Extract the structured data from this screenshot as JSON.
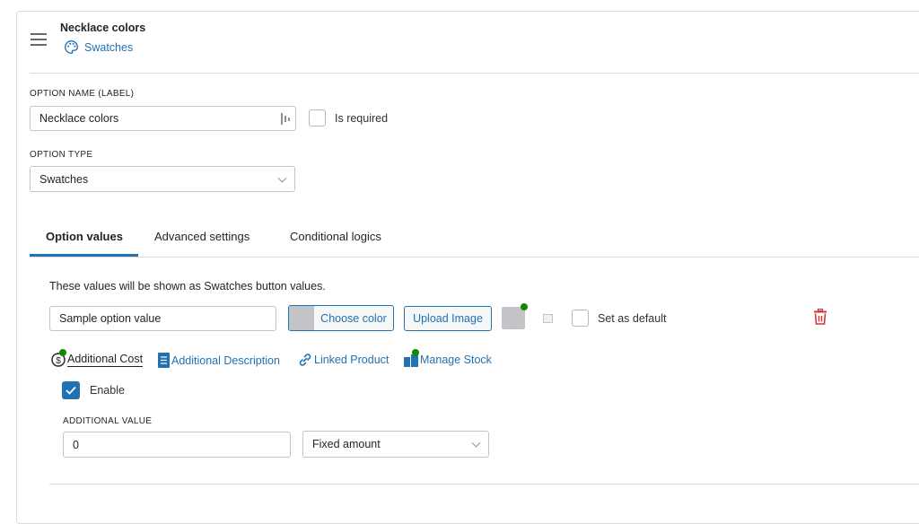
{
  "header": {
    "title": "Necklace colors",
    "subtitle": "Swatches",
    "subtitle_icon": "palette-icon"
  },
  "option_name": {
    "label": "OPTION NAME (LABEL)",
    "value": "Necklace colors",
    "required_label": "Is required",
    "required_checked": false
  },
  "option_type": {
    "label": "OPTION TYPE",
    "value": "Swatches"
  },
  "tabs": [
    {
      "label": "Option values",
      "active": true
    },
    {
      "label": "Advanced settings",
      "active": false
    },
    {
      "label": "Conditional logics",
      "active": false
    }
  ],
  "values_section": {
    "note": "These values will be shown as Swatches button values.",
    "value_input": "Sample option value",
    "choose_color": "Choose color",
    "upload_image": "Upload Image",
    "set_default_label": "Set as default",
    "set_default_checked": false
  },
  "sub_tabs": [
    {
      "label": "Additional Cost",
      "icon": "dollar-icon",
      "active": true
    },
    {
      "label": "Additional Description",
      "icon": "document-icon",
      "active": false
    },
    {
      "label": "Linked Product",
      "icon": "link-icon",
      "active": false
    },
    {
      "label": "Manage Stock",
      "icon": "stock-icon",
      "active": false
    }
  ],
  "additional_cost": {
    "enable_label": "Enable",
    "enabled": true,
    "value_label": "ADDITIONAL VALUE",
    "value": "0",
    "type_value": "Fixed amount"
  },
  "colors": {
    "accent": "#2271b1",
    "delete": "#d63638",
    "indicator": "#108a00"
  }
}
